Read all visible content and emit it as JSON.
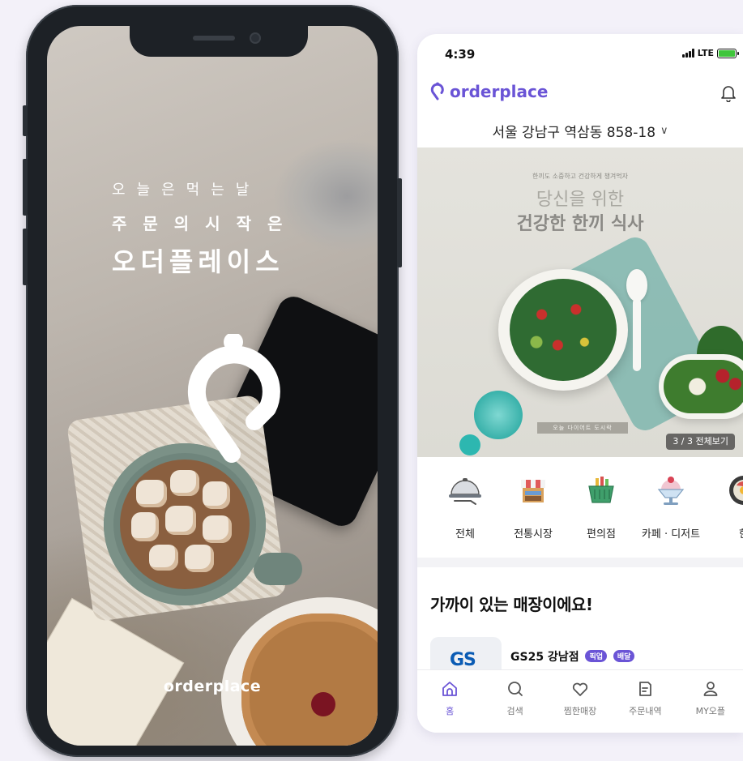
{
  "splash": {
    "line1": "오늘은먹는날",
    "line2": "주문의시작은",
    "line3": "오더플레이스",
    "wordmark": "orderplace"
  },
  "status_bar": {
    "time": "4:39",
    "network": "LTE"
  },
  "header": {
    "brand": "orderplace",
    "bell_icon": "bell-icon"
  },
  "address": {
    "text": "서울 강남구 역삼동 858-18",
    "chevron": "∨"
  },
  "banner": {
    "small_text": "한끼도 소중하고 건강하게 챙겨먹자",
    "subtitle": "당신을 위한",
    "title": "건강한 한끼 식사",
    "tag": "오늘 다이어트 도시락",
    "counter": "3 / 3  전체보기"
  },
  "categories": [
    {
      "label": "전체",
      "icon": "cloche-icon"
    },
    {
      "label": "전통시장",
      "icon": "market-stall-icon"
    },
    {
      "label": "편의점",
      "icon": "basket-icon"
    },
    {
      "label": "카페 · 디저트",
      "icon": "shaved-ice-icon"
    },
    {
      "label": "한",
      "icon": "bibimbap-icon"
    }
  ],
  "nearby": {
    "title": "가까이 있는 매장이에요!",
    "store": {
      "logo": "GS",
      "name": "GS25 강남점",
      "badges": [
        "픽업",
        "배달"
      ]
    }
  },
  "bottom_nav": [
    {
      "label": "홈",
      "icon": "home-icon",
      "active": true
    },
    {
      "label": "검색",
      "icon": "search-icon",
      "active": false
    },
    {
      "label": "찜한매장",
      "icon": "heart-icon",
      "active": false
    },
    {
      "label": "주문내역",
      "icon": "receipt-icon",
      "active": false
    },
    {
      "label": "MY오플",
      "icon": "user-icon",
      "active": false
    }
  ],
  "colors": {
    "brand": "#6a54d6",
    "page_background": "#f3f1f9",
    "phone_frame": "#1d2126"
  }
}
